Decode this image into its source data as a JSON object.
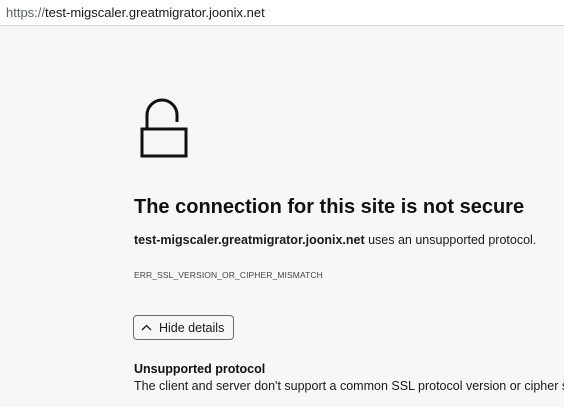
{
  "address_bar": {
    "scheme": "https://",
    "host": "test-migscaler.greatmigrator.joonix.net"
  },
  "error_page": {
    "icon": "lock-open-icon",
    "heading": "The connection for this site is not secure",
    "description_host": "test-migscaler.greatmigrator.joonix.net",
    "description_rest": " uses an unsupported protocol.",
    "error_code": "ERR_SSL_VERSION_OR_CIPHER_MISMATCH",
    "details_button_label": "Hide details",
    "details_button_icon": "chevron-up-icon",
    "details": {
      "title": "Unsupported protocol",
      "text": "The client and server don't support a common SSL protocol version or cipher suite."
    }
  }
}
